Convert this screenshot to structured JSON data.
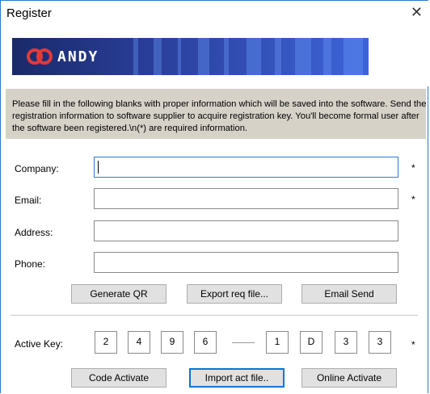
{
  "window": {
    "title": "Register"
  },
  "banner": {
    "logo_text": "ANDY"
  },
  "info": {
    "text": "Please fill in the following blanks with proper information which will be saved into the software. Send the registration information to software supplier to acquire registration key. You'll become formal user after the software been registered.\\n(*) are required information."
  },
  "form": {
    "company": {
      "label": "Company:",
      "value": "",
      "required_mark": "*"
    },
    "email": {
      "label": "Email:",
      "value": "",
      "required_mark": "*"
    },
    "address": {
      "label": "Address:",
      "value": ""
    },
    "phone": {
      "label": "Phone:",
      "value": ""
    }
  },
  "buttons_top": {
    "generate_qr": "Generate QR",
    "export_req": "Export req file...",
    "email_send": "Email Send"
  },
  "active_key": {
    "label": "Active Key:",
    "chars": [
      "2",
      "4",
      "9",
      "6",
      "1",
      "D",
      "3",
      "3"
    ],
    "required_mark": "*"
  },
  "buttons_bottom": {
    "code_activate": "Code Activate",
    "import_act": "Import act file..",
    "online_activate": "Online Activate"
  }
}
